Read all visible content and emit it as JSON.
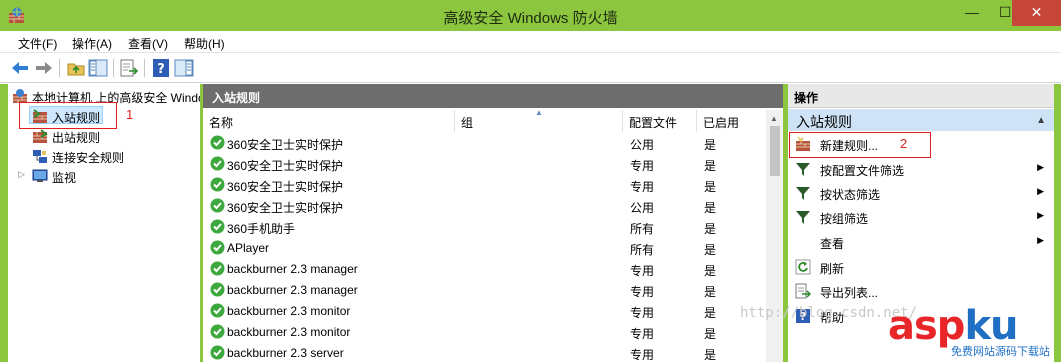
{
  "window": {
    "title": "高级安全 Windows 防火墙",
    "min_glyph": "—",
    "max_glyph": "☐",
    "close_glyph": "✕"
  },
  "menu": [
    "文件(F)",
    "操作(A)",
    "查看(V)",
    "帮助(H)"
  ],
  "tree": {
    "root": "本地计算机 上的高级安全 Windows",
    "items": [
      "入站规则",
      "出站规则",
      "连接安全规则",
      "监视"
    ],
    "annotation": "1"
  },
  "middle": {
    "title": "入站规则",
    "columns": [
      "名称",
      "组",
      "配置文件",
      "已启用"
    ],
    "rows": [
      {
        "name": "360安全卫士实时保护",
        "profile": "公用",
        "enabled": "是"
      },
      {
        "name": "360安全卫士实时保护",
        "profile": "专用",
        "enabled": "是"
      },
      {
        "name": "360安全卫士实时保护",
        "profile": "专用",
        "enabled": "是"
      },
      {
        "name": "360安全卫士实时保护",
        "profile": "公用",
        "enabled": "是"
      },
      {
        "name": "360手机助手",
        "profile": "所有",
        "enabled": "是"
      },
      {
        "name": "APlayer",
        "profile": "所有",
        "enabled": "是"
      },
      {
        "name": "backburner 2.3 manager",
        "profile": "专用",
        "enabled": "是"
      },
      {
        "name": "backburner 2.3 manager",
        "profile": "专用",
        "enabled": "是"
      },
      {
        "name": "backburner 2.3 monitor",
        "profile": "专用",
        "enabled": "是"
      },
      {
        "name": "backburner 2.3 monitor",
        "profile": "专用",
        "enabled": "是"
      },
      {
        "name": "backburner 2.3 server",
        "profile": "专用",
        "enabled": "是"
      }
    ]
  },
  "actions": {
    "header": "操作",
    "section": "入站规则",
    "items": [
      "新建规则...",
      "按配置文件筛选",
      "按状态筛选",
      "按组筛选",
      "查看",
      "刷新",
      "导出列表...",
      "帮助"
    ],
    "annotation": "2"
  },
  "watermark": "http://blog.csdn.net/",
  "logo": {
    "part1": "asp",
    "part2": "ku",
    "sub": "免费网站源码下载站"
  }
}
